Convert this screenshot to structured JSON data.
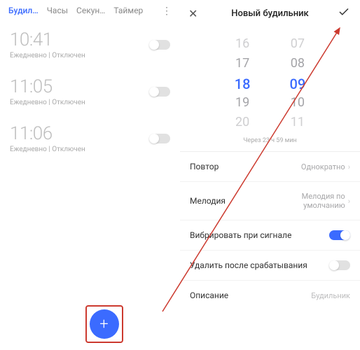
{
  "tabs": [
    "Будил…",
    "Часы",
    "Секун…",
    "Таймер"
  ],
  "alarms": [
    {
      "time": "10:41",
      "sub": "Ежедневно | Отключен"
    },
    {
      "time": "11:05",
      "sub": "Ежедневно | Отключен"
    },
    {
      "time": "11:06",
      "sub": "Ежедневно | Отключен"
    }
  ],
  "right": {
    "title": "Новый будильник",
    "hours": [
      "16",
      "17",
      "18",
      "19",
      "20"
    ],
    "minutes": [
      "07",
      "08",
      "09",
      "10",
      "11"
    ],
    "until": "Через 23 ч 59 мин",
    "rows": {
      "repeat_label": "Повтор",
      "repeat_value": "Однократно",
      "melody_label": "Мелодия",
      "melody_value": "Мелодия по умолчанию",
      "vibrate_label": "Вибрировать при сигнале",
      "delete_label": "Удалить после срабатывания",
      "desc_label": "Описание",
      "desc_value": "Будильник"
    }
  }
}
